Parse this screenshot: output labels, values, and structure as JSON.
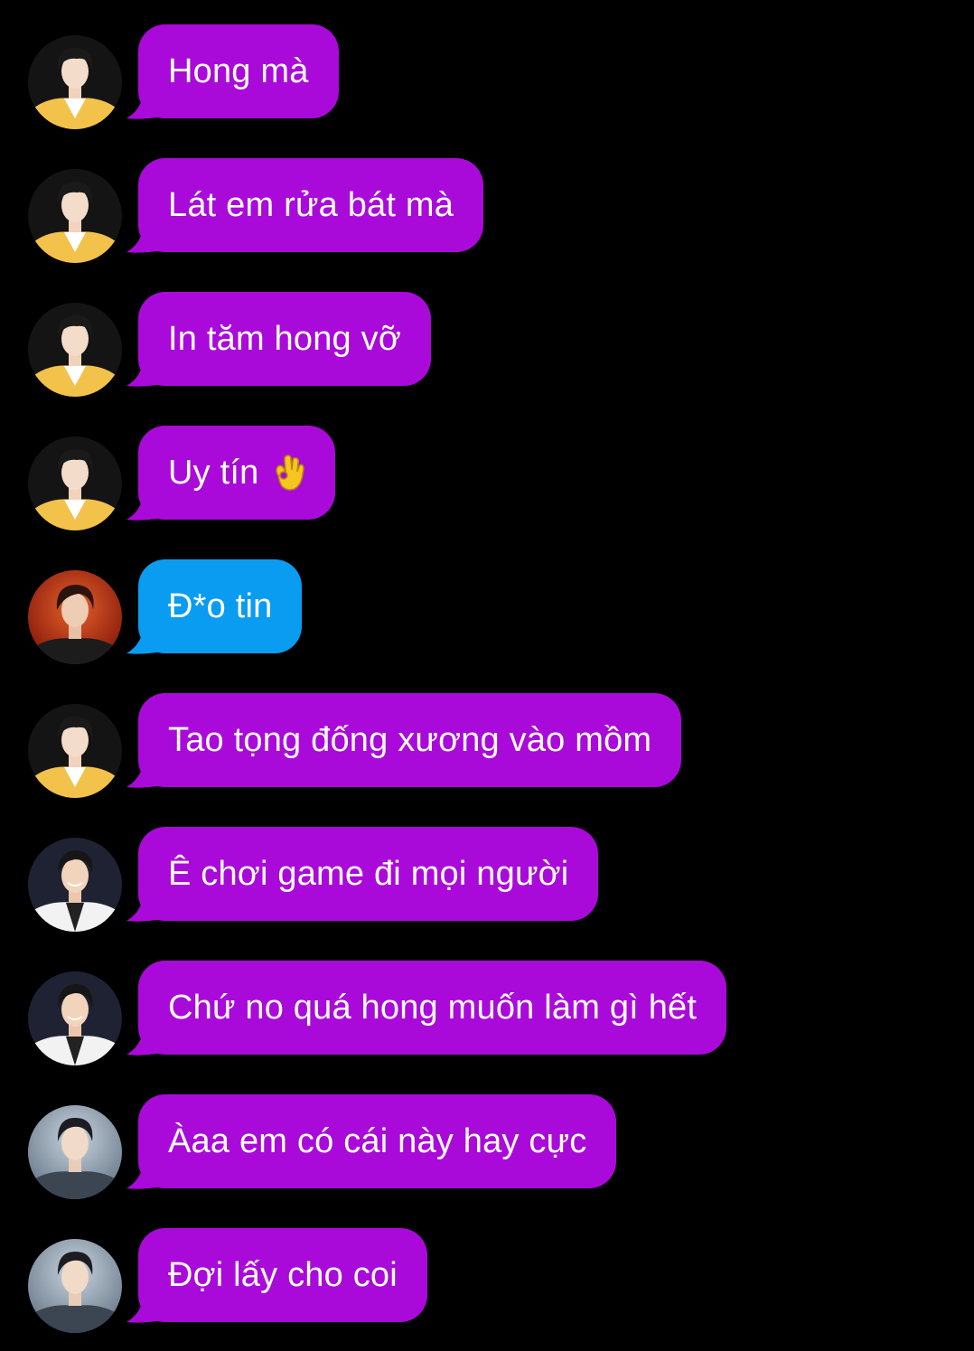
{
  "colors": {
    "background": "#000000",
    "bubble_purple": "#aa0ad9",
    "bubble_blue": "#0a9cf0",
    "text": "#ffffff"
  },
  "messages": [
    {
      "text": "Hong mà",
      "bubble": "purple",
      "avatar": "member-yellow-jacket-avatar"
    },
    {
      "text": "Lát em rửa bát mà",
      "bubble": "purple",
      "avatar": "member-yellow-jacket-avatar"
    },
    {
      "text": "In tăm hong vỡ",
      "bubble": "purple",
      "avatar": "member-yellow-jacket-avatar"
    },
    {
      "text": "Uy tín",
      "bubble": "purple",
      "avatar": "member-yellow-jacket-avatar",
      "emoji": "ok-hand-emoji"
    },
    {
      "text": "Đ*o tin",
      "bubble": "blue",
      "avatar": "member-red-stage-avatar"
    },
    {
      "text": "Tao tọng đống xương vào mồm",
      "bubble": "purple",
      "avatar": "member-yellow-jacket-avatar"
    },
    {
      "text": "Ê chơi game đi mọi người",
      "bubble": "purple",
      "avatar": "member-white-suit-avatar"
    },
    {
      "text": "Chứ no quá hong muốn làm gì hết",
      "bubble": "purple",
      "avatar": "member-white-suit-avatar"
    },
    {
      "text": "Àaa em có cái này hay cực",
      "bubble": "purple",
      "avatar": "member-grey-jacket-avatar"
    },
    {
      "text": "Đợi lấy cho coi",
      "bubble": "purple",
      "avatar": "member-grey-jacket-avatar"
    }
  ]
}
